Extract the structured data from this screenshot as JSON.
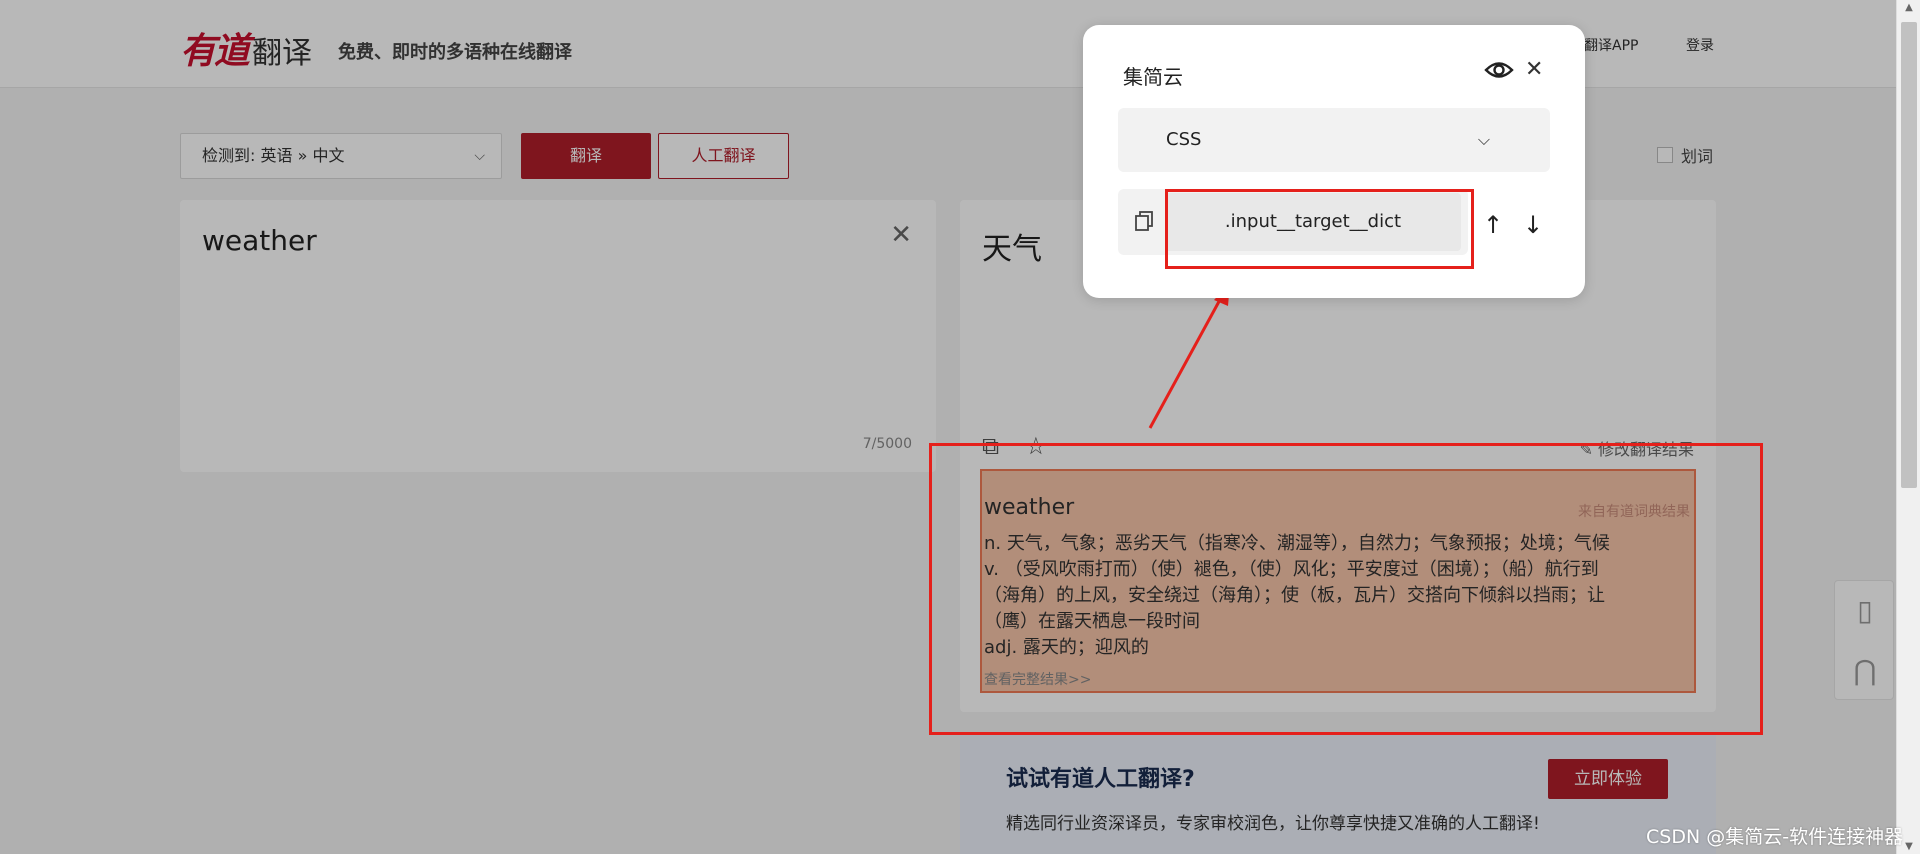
{
  "header": {
    "logo_youdao": "有道",
    "logo_fanyi": "翻译",
    "slogan": "免费、即时的多语种在线翻译",
    "app_link": "翻译APP",
    "login": "登录"
  },
  "toolbar": {
    "lang_select": "检测到: 英语 » 中文",
    "translate_button": "翻译",
    "human_translate_button": "人工翻译",
    "huaci_label": "划词"
  },
  "source": {
    "text": "weather",
    "char_count": "7/5000"
  },
  "target": {
    "text": "天气",
    "edit_result": "修改翻译结果",
    "dict": {
      "headword": "weather",
      "source_note": "来自有道词典结果",
      "lines": [
        "n. 天气，气象；恶劣天气（指寒冷、潮湿等），自然力；气象预报；处境；气候",
        "v. （受风吹雨打而）（使）褪色，（使）风化；平安度过（困境）；（船）航行到",
        "（海角）的上风，安全绕过（海角）；使（板，瓦片）交搭向下倾斜以挡雨；让",
        "（鹰）在露天栖息一段时间",
        "adj. 露天的；迎风的"
      ],
      "more_link": "查看完整结果>>"
    }
  },
  "promo": {
    "title": "试试有道人工翻译?",
    "description": "精选同行业资深译员，专家审校润色，让你尊享快捷又准确的人工翻译!",
    "button": "立即体验"
  },
  "popup": {
    "title": "集简云",
    "selector_type": "CSS",
    "selector_value": ".input__target__dict"
  },
  "watermark": "CSDN @集简云-软件连接神器",
  "colors": {
    "brand_red": "#b01e2a",
    "annotation_red": "#e5201b",
    "highlight_orange": "#f07a55"
  }
}
